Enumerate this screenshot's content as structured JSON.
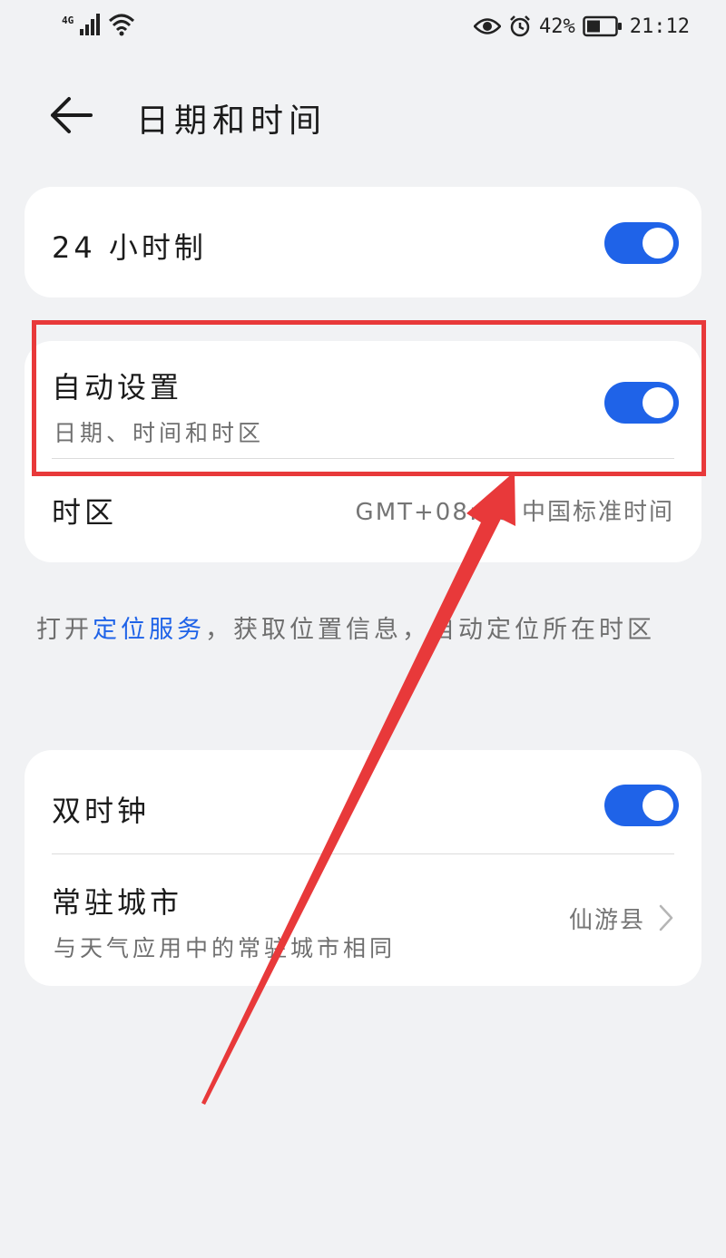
{
  "status_bar": {
    "network": "4G",
    "battery_percent": "42%",
    "time": "21:12"
  },
  "header": {
    "title": "日期和时间"
  },
  "card1": {
    "hour24_label": "24 小时制",
    "hour24_on": true
  },
  "card2": {
    "auto_label": "自动设置",
    "auto_sub": "日期、时间和时区",
    "auto_on": true,
    "timezone_label": "时区",
    "timezone_value": "GMT+08:00 中国标准时间"
  },
  "hint": {
    "prefix": "打开",
    "link": "定位服务",
    "suffix": "，获取位置信息，自动定位所在时区"
  },
  "card3": {
    "dual_clock_label": "双时钟",
    "dual_clock_on": true,
    "home_city_label": "常驻城市",
    "home_city_sub": "与天气应用中的常驻城市相同",
    "home_city_value": "仙游县"
  },
  "colors": {
    "accent": "#1f63e8",
    "annotation": "#e8393a",
    "background": "#f1f2f4"
  }
}
